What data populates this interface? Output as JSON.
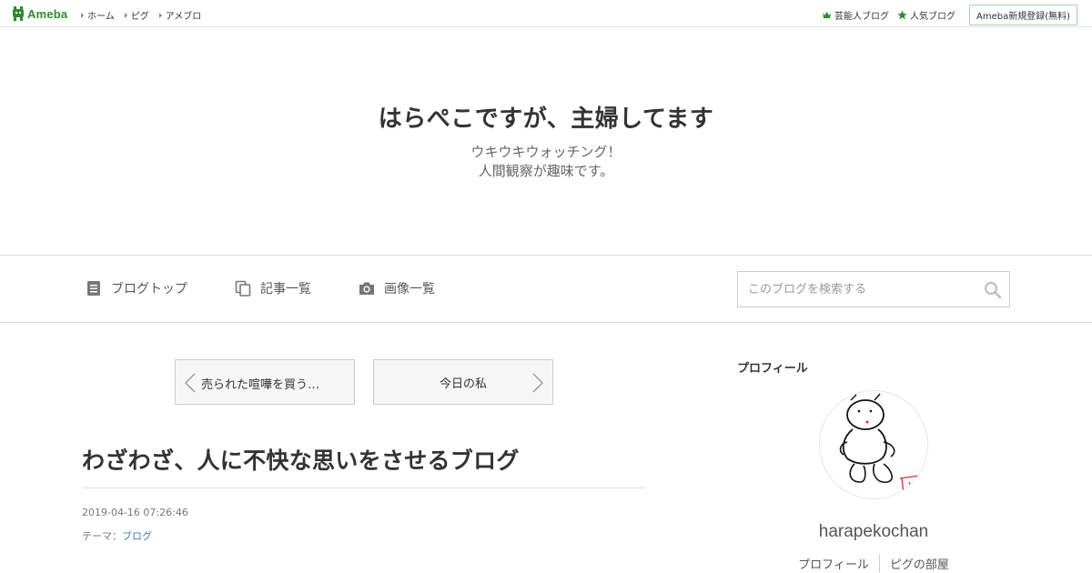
{
  "global_bar": {
    "logo_text": "Ameba",
    "nav": [
      "ホーム",
      "ピグ",
      "アメブロ"
    ],
    "right": {
      "celebrity_blog": "芸能人ブログ",
      "popular_blog": "人気ブログ",
      "register": "Ameba新規登録(無料)"
    }
  },
  "header": {
    "title": "はらぺこですが、主婦してます",
    "description_lines": [
      "ウキウキウォッチング！",
      "人間観察が趣味です。"
    ]
  },
  "nav": {
    "blog_top": "ブログトップ",
    "article_list": "記事一覧",
    "image_list": "画像一覧",
    "search_placeholder": "このブログを検索する"
  },
  "pager": {
    "prev": "売られた喧嘩を買う…",
    "next": "今日の私"
  },
  "article": {
    "title": "わざわざ、人に不快な思いをさせるブログ",
    "date": "2019-04-16 07:26:46",
    "theme_label": "テーマ：",
    "theme_value": "ブログ"
  },
  "sidebar": {
    "heading": "プロフィール",
    "name": "harapekochan",
    "links": [
      "プロフィール",
      "ピグの部屋"
    ]
  },
  "colors": {
    "brand_green": "#2d8c2d",
    "link_blue": "#3a7bbf"
  },
  "icons": {
    "logo": "ameba-logo-icon",
    "celebrity": "crown-icon",
    "popular": "star-icon",
    "blog_top": "document-icon",
    "article_list": "copy-icon",
    "image_list": "camera-icon",
    "search": "search-icon",
    "prev": "chevron-left-icon",
    "next": "chevron-right-icon"
  }
}
